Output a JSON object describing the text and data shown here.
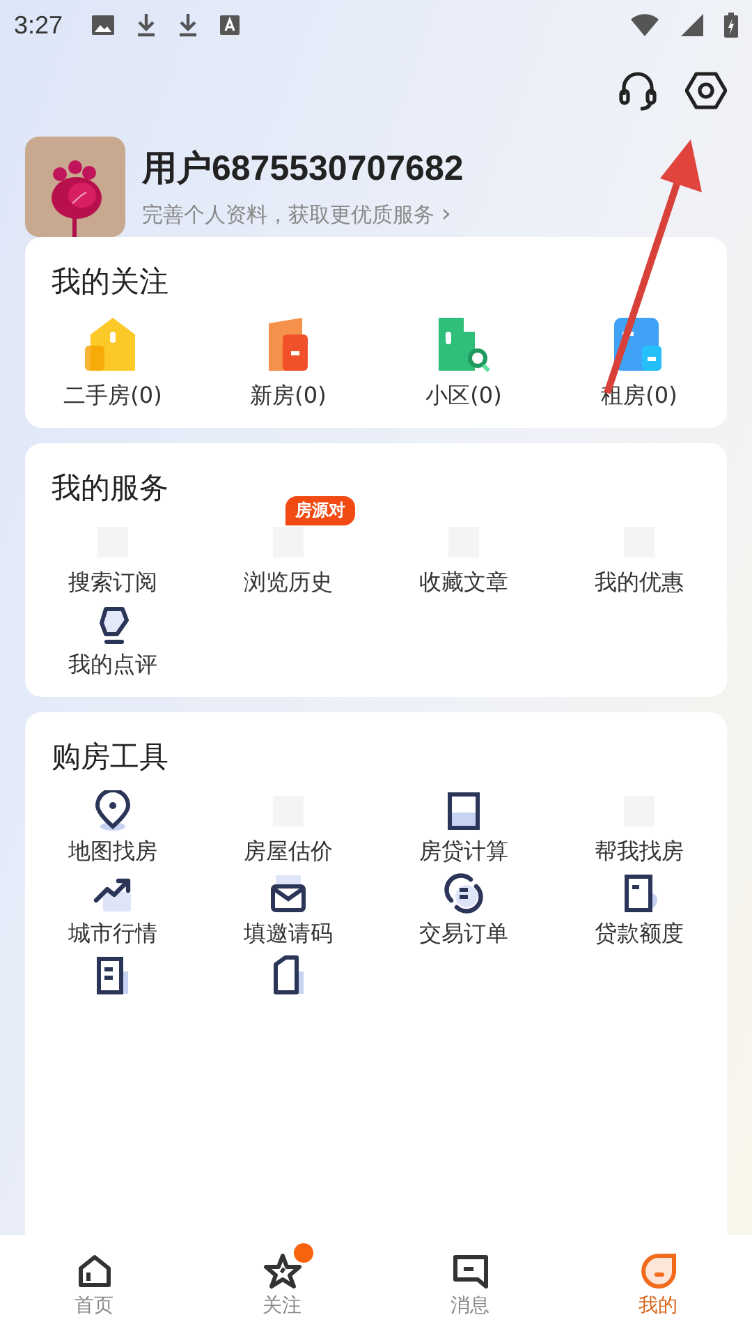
{
  "status_bar": {
    "time": "3:27"
  },
  "profile": {
    "name": "用户6875530707682",
    "subtitle": "完善个人资料，获取更优质服务",
    "chevron": "›"
  },
  "follow": {
    "title": "我的关注",
    "items": [
      {
        "label": "二手房(0)"
      },
      {
        "label": "新房(0)"
      },
      {
        "label": "小区(0)"
      },
      {
        "label": "租房(0)"
      }
    ]
  },
  "services": {
    "title": "我的服务",
    "items": [
      {
        "label": "搜索订阅"
      },
      {
        "label": "浏览历史",
        "badge": "房源对"
      },
      {
        "label": "收藏文章"
      },
      {
        "label": "我的优惠"
      },
      {
        "label": "我的点评"
      }
    ]
  },
  "tools": {
    "title": "购房工具",
    "items": [
      {
        "label": "地图找房"
      },
      {
        "label": "房屋估价"
      },
      {
        "label": "房贷计算"
      },
      {
        "label": "帮我找房"
      },
      {
        "label": "城市行情"
      },
      {
        "label": "填邀请码"
      },
      {
        "label": "交易订单"
      },
      {
        "label": "贷款额度"
      }
    ]
  },
  "tab_bar": [
    {
      "label": "首页",
      "selected": false,
      "dot": false
    },
    {
      "label": "关注",
      "selected": false,
      "dot": true
    },
    {
      "label": "消息",
      "selected": false,
      "dot": false
    },
    {
      "label": "我的",
      "selected": true,
      "dot": false
    }
  ]
}
